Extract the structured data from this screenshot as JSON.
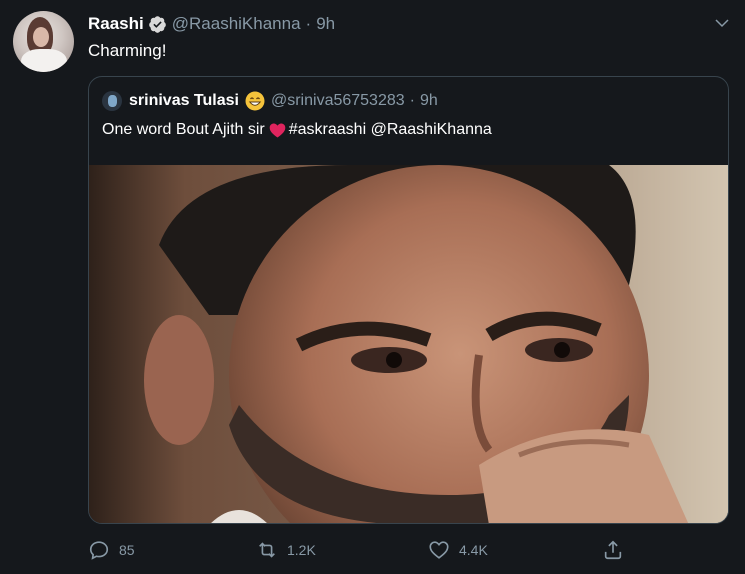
{
  "tweet": {
    "author_name": "Raashi",
    "author_handle": "@RaashiKhanna",
    "separator": "·",
    "time": "9h",
    "text": "Charming!"
  },
  "quoted_tweet": {
    "author_name": "srinivas Tulasi",
    "author_handle": "@sriniva56753283",
    "separator": "·",
    "time": "9h",
    "text_before_emoji": "One word Bout Ajith sir",
    "text_after_emoji": "#askraashi @RaashiKhanna"
  },
  "actions": {
    "reply_count": "85",
    "retweet_count": "1.2K",
    "like_count": "4.4K"
  },
  "icons": {
    "verified": "verified-badge-icon",
    "more": "chevron-down-icon",
    "emoji": "grinning-face-icon",
    "heart": "red-heart-icon",
    "reply": "reply-icon",
    "retweet": "retweet-icon",
    "like": "like-icon",
    "share": "share-icon"
  },
  "colors": {
    "background": "#15181c",
    "secondary_text": "#8899a6",
    "border": "#38444d",
    "heart": "#e0245e"
  }
}
